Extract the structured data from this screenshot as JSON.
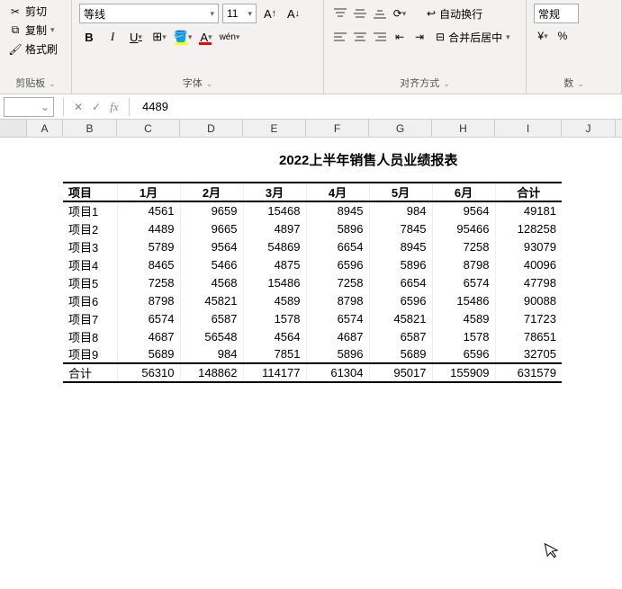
{
  "ribbon": {
    "clipboard": {
      "cut": "剪切",
      "copy": "复制",
      "format_painter": "格式刷",
      "group_label": "剪贴板"
    },
    "font": {
      "name": "等线",
      "size": "11",
      "group_label": "字体",
      "bold": "B",
      "italic": "I",
      "underline": "U",
      "wen": "wén"
    },
    "align": {
      "wrap": "自动换行",
      "merge": "合并后居中",
      "group_label": "对齐方式"
    },
    "number": {
      "format": "常规",
      "group_label": "数"
    }
  },
  "formula_bar": {
    "name_box": "",
    "value": "4489"
  },
  "columns": [
    "A",
    "B",
    "C",
    "D",
    "E",
    "F",
    "G",
    "H",
    "I",
    "J"
  ],
  "chart_data": {
    "type": "table",
    "title": "2022上半年销售人员业绩报表",
    "headers": [
      "项目",
      "1月",
      "2月",
      "3月",
      "4月",
      "5月",
      "6月",
      "合计"
    ],
    "rows": [
      [
        "项目1",
        4561,
        9659,
        15468,
        8945,
        984,
        9564,
        49181
      ],
      [
        "项目2",
        4489,
        9665,
        4897,
        5896,
        7845,
        95466,
        128258
      ],
      [
        "项目3",
        5789,
        9564,
        54869,
        6654,
        8945,
        7258,
        93079
      ],
      [
        "项目4",
        8465,
        5466,
        4875,
        6596,
        5896,
        8798,
        40096
      ],
      [
        "项目5",
        7258,
        4568,
        15486,
        7258,
        6654,
        6574,
        47798
      ],
      [
        "项目6",
        8798,
        45821,
        4589,
        8798,
        6596,
        15486,
        90088
      ],
      [
        "项目7",
        6574,
        6587,
        1578,
        6574,
        45821,
        4589,
        71723
      ],
      [
        "项目8",
        4687,
        56548,
        4564,
        4687,
        6587,
        1578,
        78651
      ],
      [
        "项目9",
        5689,
        984,
        7851,
        5896,
        5689,
        6596,
        32705
      ]
    ],
    "totals": [
      "合计",
      56310,
      148862,
      114177,
      61304,
      95017,
      155909,
      631579
    ]
  }
}
